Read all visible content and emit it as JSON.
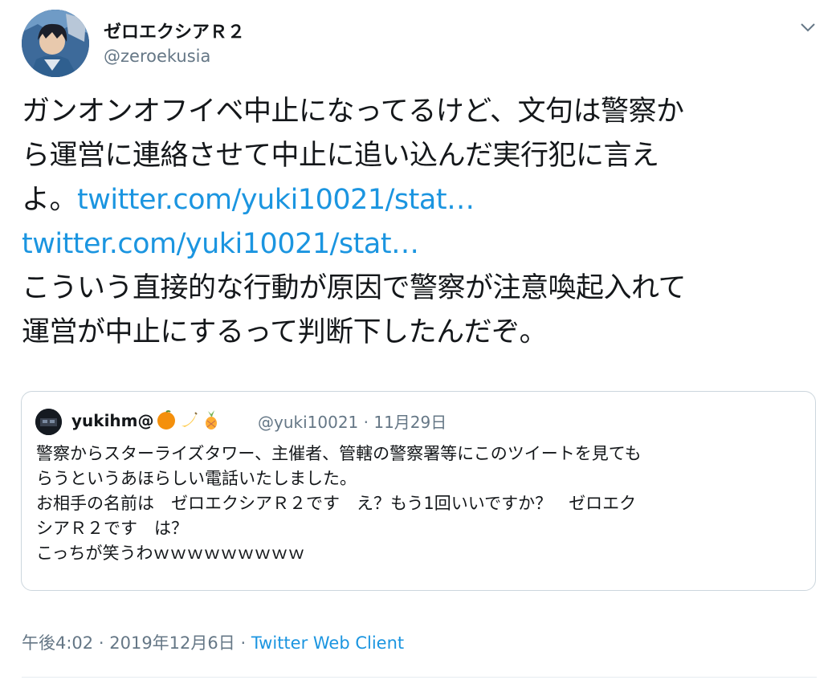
{
  "author": {
    "display_name": "ゼロエクシアＲ２",
    "handle": "@zeroekusia"
  },
  "tweet": {
    "line1": "ガンオンオフイベ中止になってるけど、文句は警察か",
    "line2": "ら運営に連絡させて中止に追い込んだ実行犯に言え",
    "line3_text": "よ。",
    "link1": "twitter.com/yuki10021/stat…",
    "link2": "twitter.com/yuki10021/stat…",
    "line5": "こういう直接的な行動が原因で警察が注意喚起入れて",
    "line6": "運営が中止にするって判断下したんだぞ。"
  },
  "quoted": {
    "display_name": "yukihm@",
    "emoji": [
      "orange-icon",
      "banana-icon",
      "pineapple-icon"
    ],
    "handle": "@yuki10021",
    "separator": "·",
    "date": "11月29日",
    "lines": [
      "警察からスターライズタワー、主催者、管轄の警察署等にこのツイートを見ても",
      "らうというあほらしい電話いたしました。",
      "お相手の名前は　ゼロエクシアＲ２です　え？もう1回いいですか？　ゼロエク",
      "シアＲ２です　は？",
      "こっちが笑うわｗｗｗｗｗｗｗｗｗ"
    ]
  },
  "footer": {
    "time": "午後4:02",
    "separator": "·",
    "date": "2019年12月6日",
    "separator2": "·",
    "source": "Twitter Web Client"
  }
}
